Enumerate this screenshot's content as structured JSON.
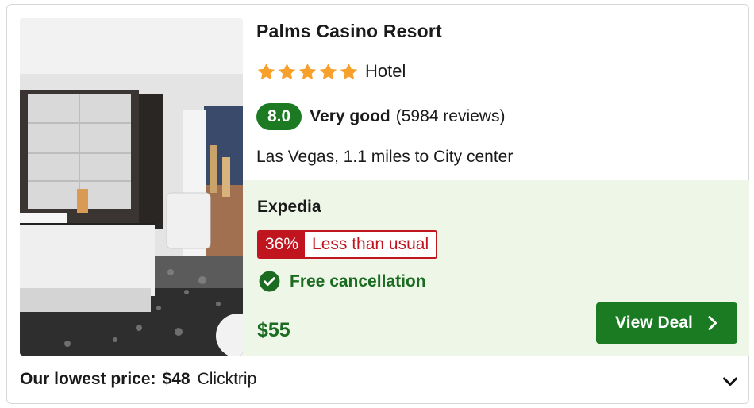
{
  "hotel": {
    "name": "Palms Casino Resort",
    "star_count": 5,
    "type": "Hotel",
    "score": "8.0",
    "rating_word": "Very good",
    "review_count": "(5984 reviews)",
    "location": "Las Vegas, 1.1 miles to City center"
  },
  "deal": {
    "provider": "Expedia",
    "discount_percent": "36%",
    "discount_text": "Less than usual",
    "free_cancellation": "Free cancellation",
    "price": "$55",
    "button_label": "View Deal"
  },
  "footer": {
    "lowest_price_label": "Our lowest price:",
    "lowest_price": "$48",
    "lowest_price_provider": "Clicktrip"
  },
  "colors": {
    "accent_green": "#1a7b22",
    "deal_background": "#edf6e7",
    "discount_red": "#c0141f",
    "star_orange": "#f7a02b"
  },
  "icons": [
    "star-icon",
    "check-circle-icon",
    "chevron-right-icon",
    "chevron-down-icon"
  ]
}
